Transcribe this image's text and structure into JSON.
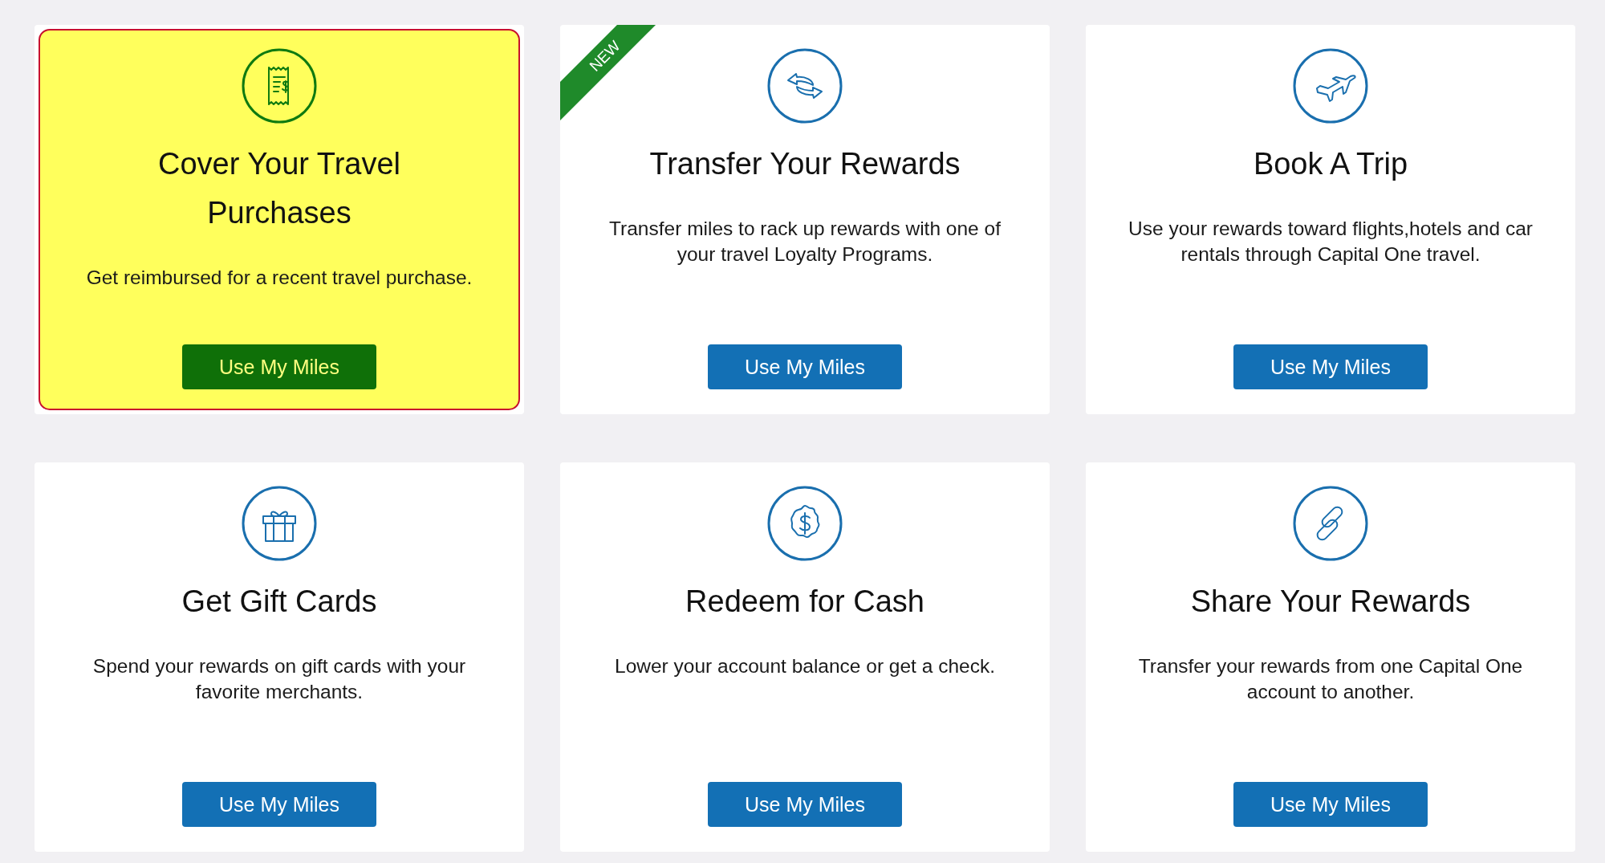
{
  "cards": [
    {
      "title": "Cover Your Travel Purchases",
      "description": "Get reimbursed for a recent travel purchase.",
      "button": "Use My Miles",
      "highlighted": true
    },
    {
      "title": "Transfer Your Rewards",
      "description": "Transfer miles to rack up rewards with one of your travel Loyalty Programs.",
      "button": "Use My Miles",
      "highlighted": false,
      "badge": "NEW"
    },
    {
      "title": "Book A Trip",
      "description": "Use your rewards toward flights,hotels and car rentals through Capital One travel.",
      "button": "Use My Miles",
      "highlighted": false
    },
    {
      "title": "Get Gift Cards",
      "description": "Spend your rewards on gift cards with your favorite merchants.",
      "button": "Use My Miles",
      "highlighted": false
    },
    {
      "title": "Redeem for Cash",
      "description": "Lower your account balance or get a check.",
      "button": "Use My Miles",
      "highlighted": false
    },
    {
      "title": "Share Your Rewards",
      "description": "Transfer your rewards from one Capital One account to another.",
      "button": "Use My Miles",
      "highlighted": false
    }
  ]
}
